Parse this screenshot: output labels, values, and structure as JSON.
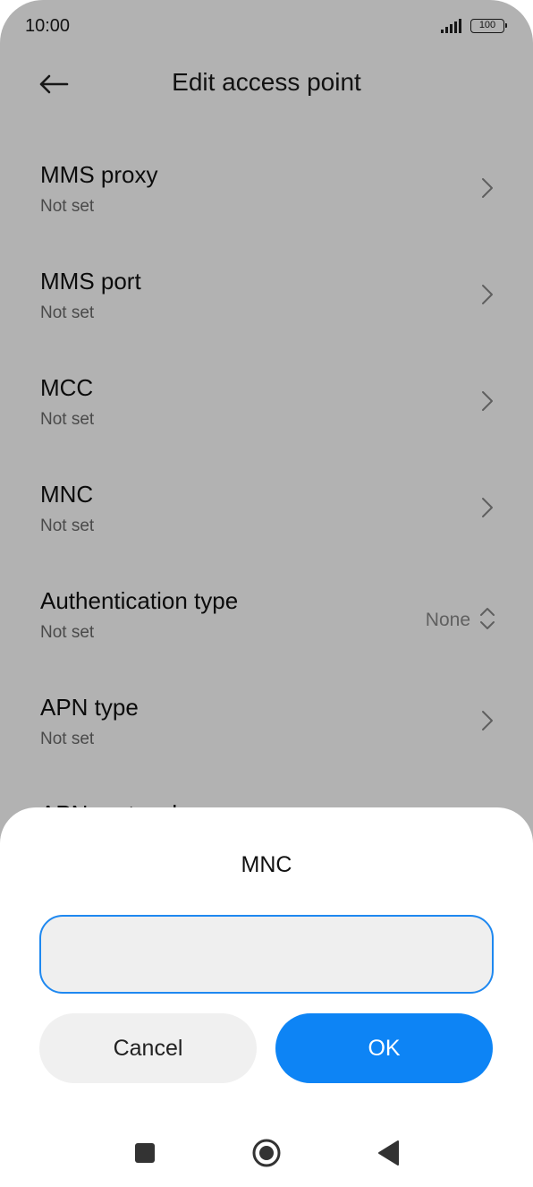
{
  "status_bar": {
    "time": "10:00",
    "battery": "100"
  },
  "header": {
    "title": "Edit access point"
  },
  "list": [
    {
      "title": "MMS proxy",
      "subtitle": "Not set"
    },
    {
      "title": "MMS port",
      "subtitle": "Not set"
    },
    {
      "title": "MCC",
      "subtitle": "Not set"
    },
    {
      "title": "MNC",
      "subtitle": "Not set"
    },
    {
      "title": "Authentication type",
      "subtitle": "Not set",
      "value": "None"
    },
    {
      "title": "APN type",
      "subtitle": "Not set"
    },
    {
      "title": "APN protocol",
      "subtitle": ""
    }
  ],
  "dialog": {
    "title": "MNC",
    "input_value": "",
    "cancel_label": "Cancel",
    "ok_label": "OK"
  },
  "colors": {
    "accent": "#0d84f5",
    "input_border": "#1e88f0"
  },
  "icons": {
    "back": "arrow-left-icon",
    "chevron": "chevron-right-icon",
    "updown": "chevron-updown-icon",
    "nav_recents": "square-icon",
    "nav_home": "circle-icon",
    "nav_back": "triangle-back-icon"
  }
}
